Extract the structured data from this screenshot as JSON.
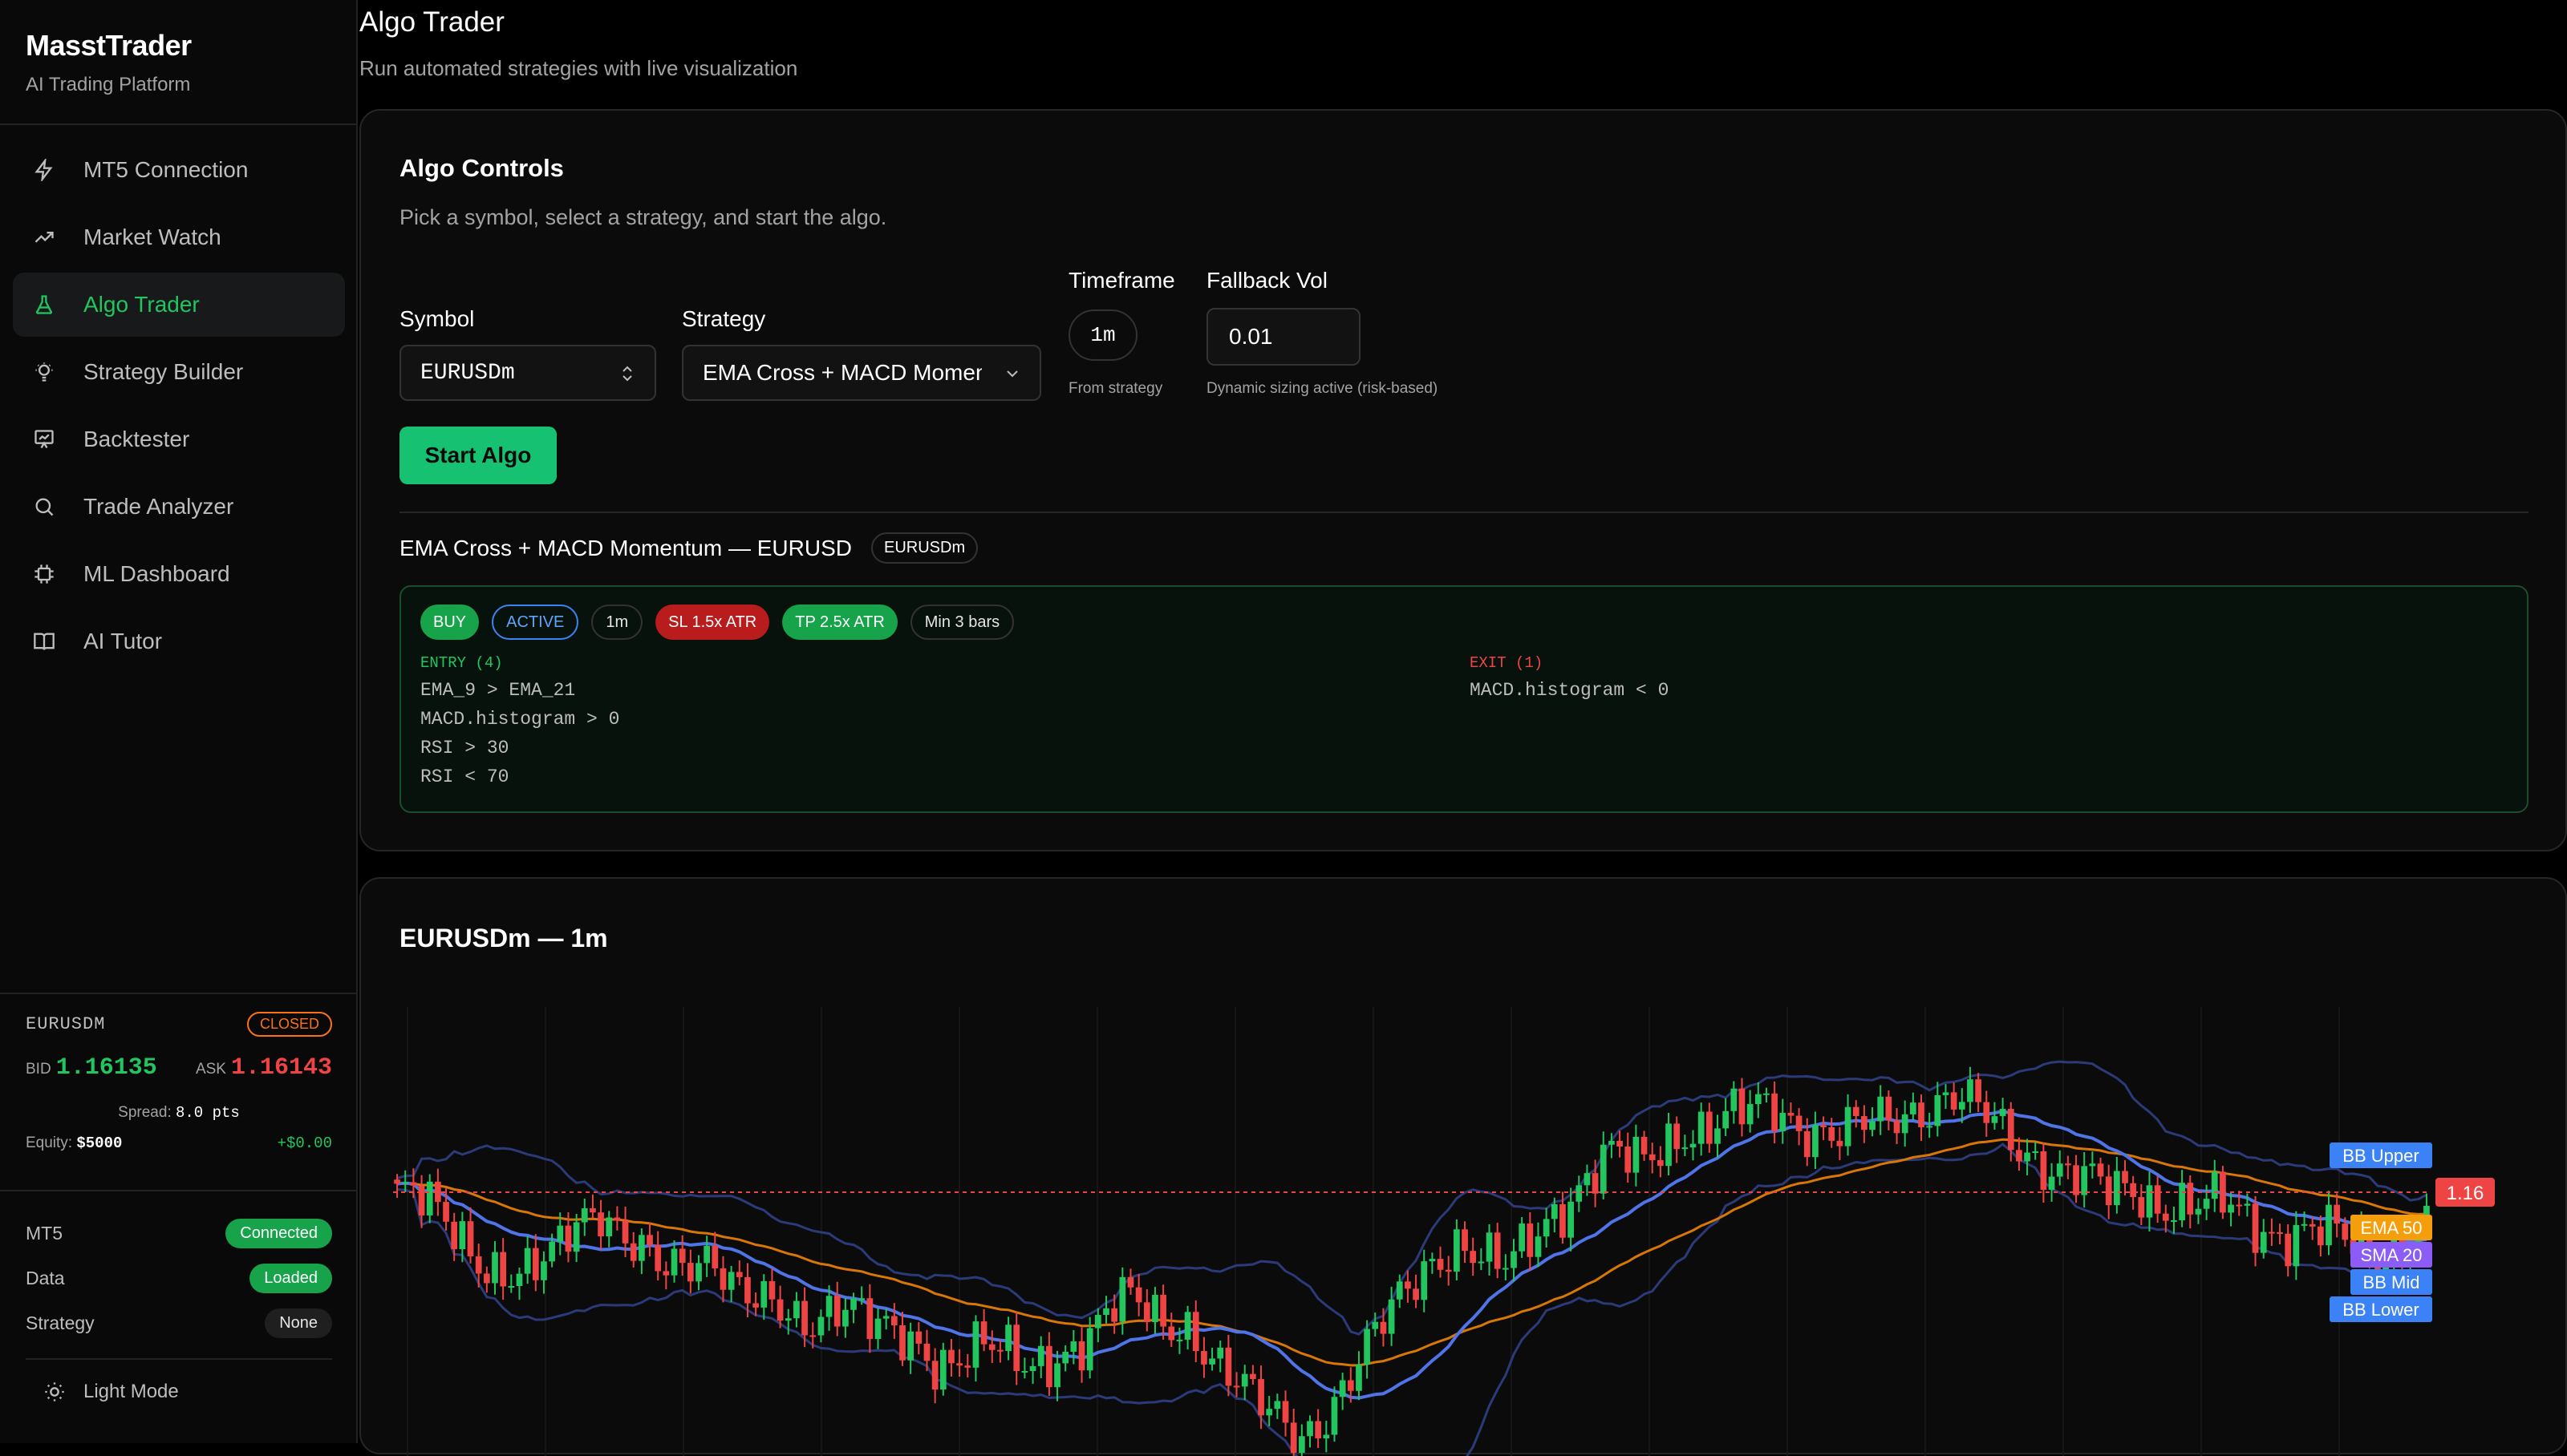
{
  "app": {
    "name": "MasstTrader",
    "tagline": "AI Trading Platform"
  },
  "sidebar": {
    "items": [
      {
        "label": "MT5 Connection",
        "icon": "lightning-icon"
      },
      {
        "label": "Market Watch",
        "icon": "trending-up-icon"
      },
      {
        "label": "Algo Trader",
        "icon": "flask-icon",
        "active": true
      },
      {
        "label": "Strategy Builder",
        "icon": "lightbulb-icon"
      },
      {
        "label": "Backtester",
        "icon": "presentation-chart-icon"
      },
      {
        "label": "Trade Analyzer",
        "icon": "search-icon"
      },
      {
        "label": "ML Dashboard",
        "icon": "cpu-icon"
      },
      {
        "label": "AI Tutor",
        "icon": "book-icon"
      }
    ],
    "ticker": {
      "symbol": "EURUSDM",
      "market_status": "CLOSED",
      "bid_label": "BID",
      "bid": "1.16135",
      "ask_label": "ASK",
      "ask": "1.16143",
      "spread_label": "Spread:",
      "spread": "8.0 pts",
      "equity_label": "Equity:",
      "equity": "$5000",
      "pnl": "+$0.00"
    },
    "status": [
      {
        "label": "MT5",
        "value": "Connected"
      },
      {
        "label": "Data",
        "value": "Loaded"
      },
      {
        "label": "Strategy",
        "value": "None"
      }
    ],
    "theme_toggle": "Light Mode"
  },
  "header": {
    "title": "Algo Trader",
    "subtitle": "Run automated strategies with live visualization"
  },
  "controls": {
    "title": "Algo Controls",
    "subtitle": "Pick a symbol, select a strategy, and start the algo.",
    "symbol_label": "Symbol",
    "symbol_value": "EURUSDm",
    "strategy_label": "Strategy",
    "strategy_value": "EMA Cross + MACD Momentum",
    "timeframe_label": "Timeframe",
    "timeframe_value": "1m",
    "timeframe_help": "From strategy",
    "fallback_label": "Fallback Vol",
    "fallback_value": "0.01",
    "fallback_help": "Dynamic sizing active (risk-based)",
    "start_button": "Start Algo",
    "strategy_heading": "EMA Cross + MACD Momentum — EURUSD",
    "strategy_symbol_badge": "EURUSDm",
    "chips": {
      "side": "BUY",
      "state": "ACTIVE",
      "tf": "1m",
      "sl": "SL 1.5x ATR",
      "tp": "TP 2.5x ATR",
      "min_bars": "Min 3 bars"
    },
    "entry_heading": "ENTRY (4)",
    "entry_rules": [
      "EMA_9 > EMA_21",
      "MACD.histogram > 0",
      "RSI > 30",
      "RSI < 70"
    ],
    "exit_heading": "EXIT (1)",
    "exit_rules": [
      "MACD.histogram < 0"
    ]
  },
  "chart_panel": {
    "title": "EURUSDm — 1m"
  },
  "chart_data": {
    "type": "candlestick",
    "symbol": "EURUSDm",
    "timeframe": "1m",
    "current_price_label": "1.16",
    "indicators": [
      {
        "name": "BB Upper",
        "color": "#3b82f6"
      },
      {
        "name": "EMA 50",
        "color": "#f59e0b"
      },
      {
        "name": "SMA 20",
        "color": "#8b5cf6"
      },
      {
        "name": "BB Mid",
        "color": "#3b82f6"
      },
      {
        "name": "BB Lower",
        "color": "#3b82f6"
      }
    ],
    "colors": {
      "up": "#22c55e",
      "down": "#ef4444",
      "price_line": "#ef4444",
      "ema50": "#d97706",
      "sma20": "#4f74e8",
      "bands": "#2b3a78"
    },
    "close_series": [
      1.16148,
      1.16142,
      1.16128,
      1.16112,
      1.16098,
      1.1609,
      1.16088,
      1.16102,
      1.16128,
      1.1614,
      1.16121,
      1.16102,
      1.16086,
      1.16094,
      1.16106,
      1.16088,
      1.16072,
      1.16058,
      1.16046,
      1.16064,
      1.16078,
      1.1606,
      1.16042,
      1.1603,
      1.16022,
      1.16038,
      1.16048,
      1.16032,
      1.16014,
      1.16024,
      1.1604,
      1.16058,
      1.16074,
      1.16064,
      1.16048,
      1.16054,
      1.16038,
      1.16018,
      1.15998,
      1.15984,
      1.15974,
      1.15988,
      1.1601,
      1.16034,
      1.1606,
      1.16084,
      1.16104,
      1.16112,
      1.161,
      1.1609,
      1.1611,
      1.16132,
      1.16144,
      1.1616,
      1.16174,
      1.16168,
      1.16182,
      1.16194,
      1.1619,
      1.16198,
      1.16206,
      1.16212,
      1.162,
      1.1619,
      1.16186,
      1.16194,
      1.16202,
      1.16208,
      1.1621,
      1.16214,
      1.16206,
      1.16196,
      1.16182,
      1.1617,
      1.1616,
      1.16154,
      1.16148,
      1.16152,
      1.16142,
      1.16138,
      1.16136,
      1.1614,
      1.1613,
      1.16122,
      1.16118,
      1.1612,
      1.16116,
      1.16108,
      1.16104,
      1.16112,
      1.16124
    ]
  }
}
